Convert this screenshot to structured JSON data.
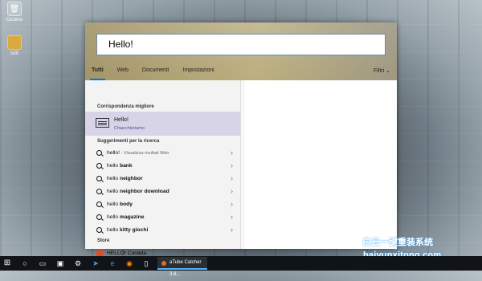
{
  "desktop": {
    "icons": [
      "Cestino",
      "tutti"
    ],
    "watermark": [
      "白云一键重装系统",
      "baiyunxitong.com"
    ]
  },
  "search": {
    "query": "Hello!",
    "tabs": [
      "Tutti",
      "Web",
      "Documenti",
      "Impostazioni"
    ],
    "filter_label": "Filtri"
  },
  "results": {
    "best_match_heading": "Corrispondenza migliore",
    "best_match": {
      "title": "Hello!",
      "subtitle": "Chiacchieriamo"
    },
    "suggestions_heading": "Suggerimenti per la ricerca",
    "suggestions": [
      {
        "prefix": "hello!",
        "rest": " - Visualizza risultati Web"
      },
      {
        "prefix": "hello",
        "rest": " bank"
      },
      {
        "prefix": "hello",
        "rest": " neighbor"
      },
      {
        "prefix": "hello",
        "rest": " neighbor download"
      },
      {
        "prefix": "hello",
        "rest": " body"
      },
      {
        "prefix": "hello",
        "rest": " magazine"
      },
      {
        "prefix": "hello",
        "rest": " kitty giochi"
      }
    ],
    "store_heading": "Store",
    "store_item": "HELLO! Canada"
  },
  "taskbar": {
    "app_label": "aTube Catcher 3.8...",
    "icons": [
      "windows-icon",
      "cortana-icon",
      "task-view-icon",
      "file-explorer-icon",
      "settings-icon",
      "telegram-icon",
      "edge-icon",
      "firefox-icon",
      "phone-icon",
      "video-icon"
    ]
  }
}
